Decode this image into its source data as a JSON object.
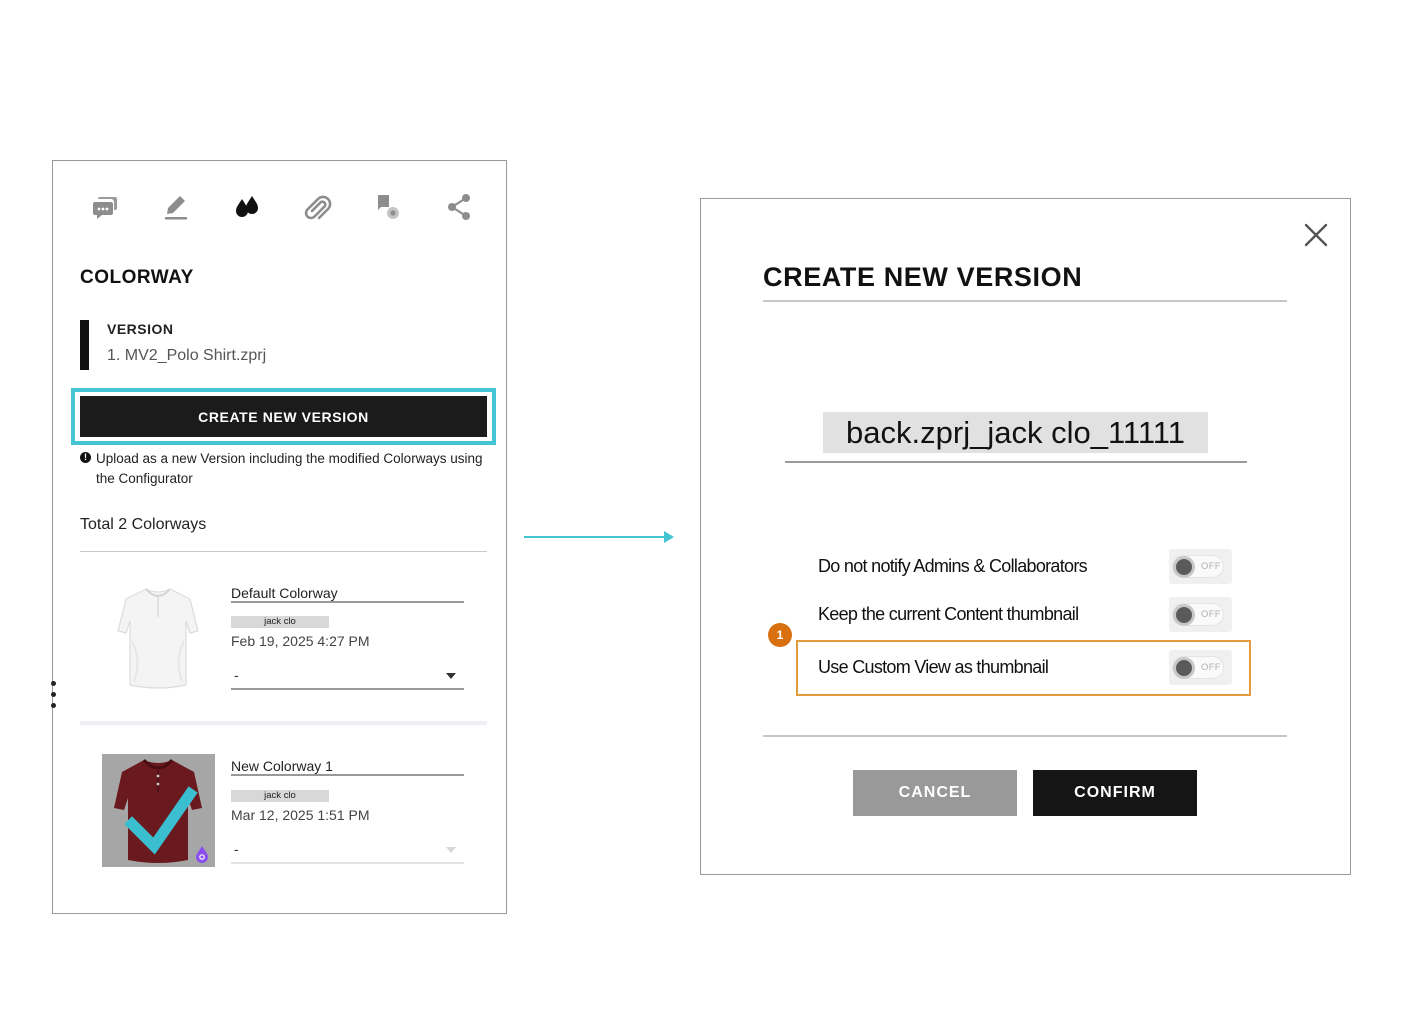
{
  "left_panel": {
    "toolbar": {
      "icons": [
        "comments-icon",
        "edit-icon",
        "colorway-drops-icon",
        "attachment-icon",
        "pin-icon",
        "share-icon"
      ]
    },
    "title": "COLORWAY",
    "version": {
      "label": "VERSION",
      "file": "1. MV2_Polo Shirt.zprj"
    },
    "create_button_label": "CREATE NEW VERSION",
    "info_text": "Upload as a new Version including the modified Colorways using the Configurator",
    "info_icon_glyph": "!",
    "total_label": "Total 2 Colorways",
    "colorways": [
      {
        "name": "Default Colorway",
        "tag": "jack clo",
        "date": "Feb 19, 2025 4:27 PM",
        "select_value": "-"
      },
      {
        "name": "New Colorway 1",
        "tag": "jack clo",
        "date": "Mar 12, 2025 1:51 PM",
        "select_value": "-"
      }
    ]
  },
  "dialog": {
    "title": "CREATE NEW VERSION",
    "file_name": "back.zprj_jack clo_11111",
    "options": [
      {
        "label": "Do not notify Admins & Collaborators",
        "state": "OFF"
      },
      {
        "label": "Keep the current Content thumbnail",
        "state": "OFF"
      },
      {
        "label": "Use Custom View as thumbnail",
        "state": "OFF"
      }
    ],
    "step_badge": "1",
    "cancel_label": "CANCEL",
    "confirm_label": "CONFIRM"
  },
  "colors": {
    "highlight_cyan": "#45c4d4",
    "highlight_orange": "#e29a3a",
    "badge_orange": "#d8700f",
    "button_dark": "#1b1b1b",
    "button_gray": "#999999",
    "shirt_maroon": "#6a1a1e",
    "check_cyan": "#3bbfd0",
    "drop_purple": "#8a4ef0"
  }
}
